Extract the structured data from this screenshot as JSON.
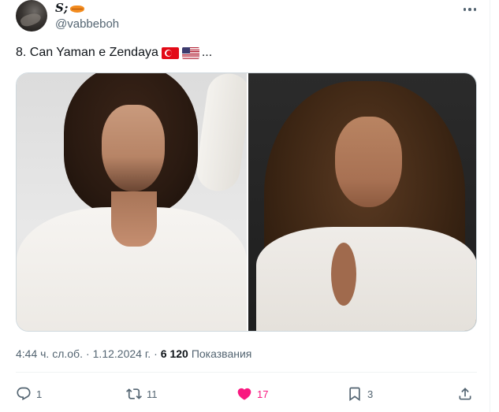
{
  "author": {
    "display_name": "S;",
    "handle": "@vabbeboh"
  },
  "tweet": {
    "text": "8. Can Yaman e Zendaya",
    "ellipsis": "..."
  },
  "meta": {
    "time": "4:44 ч. сл.об.",
    "separator1": "·",
    "date": "1.12.2024 г.",
    "separator2": "·",
    "views_count": "6 120",
    "views_label": "Показвания"
  },
  "actions": {
    "replies": "1",
    "retweets": "11",
    "likes": "17",
    "bookmarks": "3"
  },
  "colors": {
    "like_active": "#f91880",
    "muted_text": "#536471",
    "text": "#0f1419"
  },
  "icons": [
    "more-icon",
    "reply-icon",
    "retweet-icon",
    "like-icon",
    "bookmark-icon",
    "share-icon",
    "turkey-flag-icon",
    "usa-flag-icon",
    "lips-emoji-icon"
  ]
}
